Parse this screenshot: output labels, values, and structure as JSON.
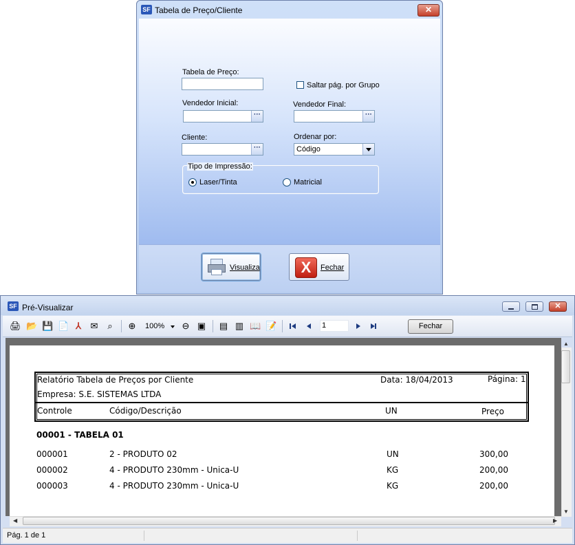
{
  "dialog": {
    "title": "Tabela de Preço/Cliente",
    "logo": "SF",
    "close_glyph": "✕",
    "fields": {
      "tabela_label": "Tabela de Preço:",
      "saltar_label": "Saltar pág. por Grupo",
      "vendedor_inicial_label": "Vendedor Inicial:",
      "vendedor_final_label": "Vendedor Final:",
      "cliente_label": "Cliente:",
      "ordenar_label": "Ordenar por:",
      "ordenar_value": "Código",
      "tipo_label": "Tipo de Impressão:",
      "laser_label": "Laser/Tinta",
      "matricial_label": "Matricial",
      "dots": "···"
    },
    "buttons": {
      "visualiza": "Visualiza",
      "fechar": "Fechar",
      "fechar_icon": "X"
    }
  },
  "preview": {
    "title": "Pré-Visualizar",
    "logo": "SF",
    "close_glyph": "✕",
    "toolbar": {
      "zoom": "100%",
      "page_input": "1",
      "fechar": "Fechar"
    },
    "status": "Pág. 1 de 1",
    "report": {
      "title": "Relatório Tabela de Preços por Cliente",
      "date": "Data: 18/04/2013",
      "page": "Página: 1",
      "empresa": "Empresa: S.E. SISTEMAS LTDA",
      "columns": [
        "Controle",
        "Código/Descrição",
        "UN",
        "Preço"
      ],
      "group": "00001 - TABELA 01",
      "rows": [
        {
          "controle": "000001",
          "descricao": "2 - PRODUTO 02",
          "un": "UN",
          "preco": "300,00"
        },
        {
          "controle": "000002",
          "descricao": "4 - PRODUTO 230mm - Unica-U",
          "un": "KG",
          "preco": "200,00"
        },
        {
          "controle": "000003",
          "descricao": "4 - PRODUTO 230mm - Unica-U",
          "un": "KG",
          "preco": "200,00"
        }
      ]
    }
  }
}
